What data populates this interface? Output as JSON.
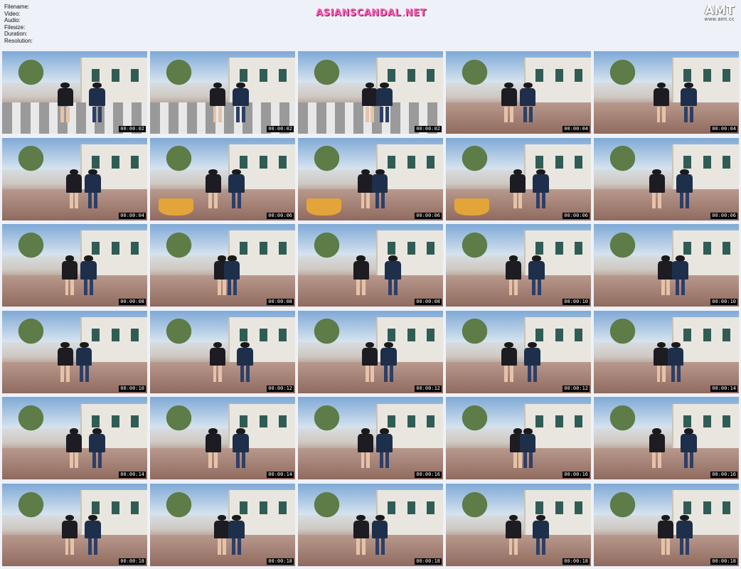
{
  "meta": {
    "filename_label": "Filename:",
    "video_label": "Video:",
    "audio_label": "Audio:",
    "filesize_label": "Filesize:",
    "duration_label": "Duration:",
    "resolution_label": "Resolution:"
  },
  "brand": {
    "left": "ASIANSCANDAL",
    "dot": ".",
    "right": "NET"
  },
  "amt": {
    "logo": "AMT",
    "url": "www.amt.cc"
  },
  "thumbnails": [
    {
      "time": "00:00:02",
      "scene": "cross"
    },
    {
      "time": "00:00:02",
      "scene": "cross"
    },
    {
      "time": "00:00:02",
      "scene": "cross"
    },
    {
      "time": "00:00:04",
      "scene": "street"
    },
    {
      "time": "00:00:04",
      "scene": "street"
    },
    {
      "time": "00:00:04",
      "scene": "street"
    },
    {
      "time": "00:00:06",
      "scene": "pot"
    },
    {
      "time": "00:00:06",
      "scene": "pot"
    },
    {
      "time": "00:00:06",
      "scene": "pot"
    },
    {
      "time": "00:00:06",
      "scene": "street"
    },
    {
      "time": "00:00:08",
      "scene": "street"
    },
    {
      "time": "00:00:08",
      "scene": "street"
    },
    {
      "time": "00:00:08",
      "scene": "street"
    },
    {
      "time": "00:00:10",
      "scene": "street"
    },
    {
      "time": "00:00:10",
      "scene": "street"
    },
    {
      "time": "00:00:10",
      "scene": "street"
    },
    {
      "time": "00:00:12",
      "scene": "street"
    },
    {
      "time": "00:00:12",
      "scene": "street"
    },
    {
      "time": "00:00:12",
      "scene": "street"
    },
    {
      "time": "00:00:14",
      "scene": "street"
    },
    {
      "time": "00:00:14",
      "scene": "street"
    },
    {
      "time": "00:00:14",
      "scene": "street"
    },
    {
      "time": "00:00:16",
      "scene": "street"
    },
    {
      "time": "00:00:16",
      "scene": "street"
    },
    {
      "time": "00:00:16",
      "scene": "street"
    },
    {
      "time": "00:00:18",
      "scene": "street"
    },
    {
      "time": "00:00:18",
      "scene": "street"
    },
    {
      "time": "00:00:18",
      "scene": "street"
    },
    {
      "time": "00:00:18",
      "scene": "street"
    },
    {
      "time": "00:00:18",
      "scene": "street"
    }
  ]
}
